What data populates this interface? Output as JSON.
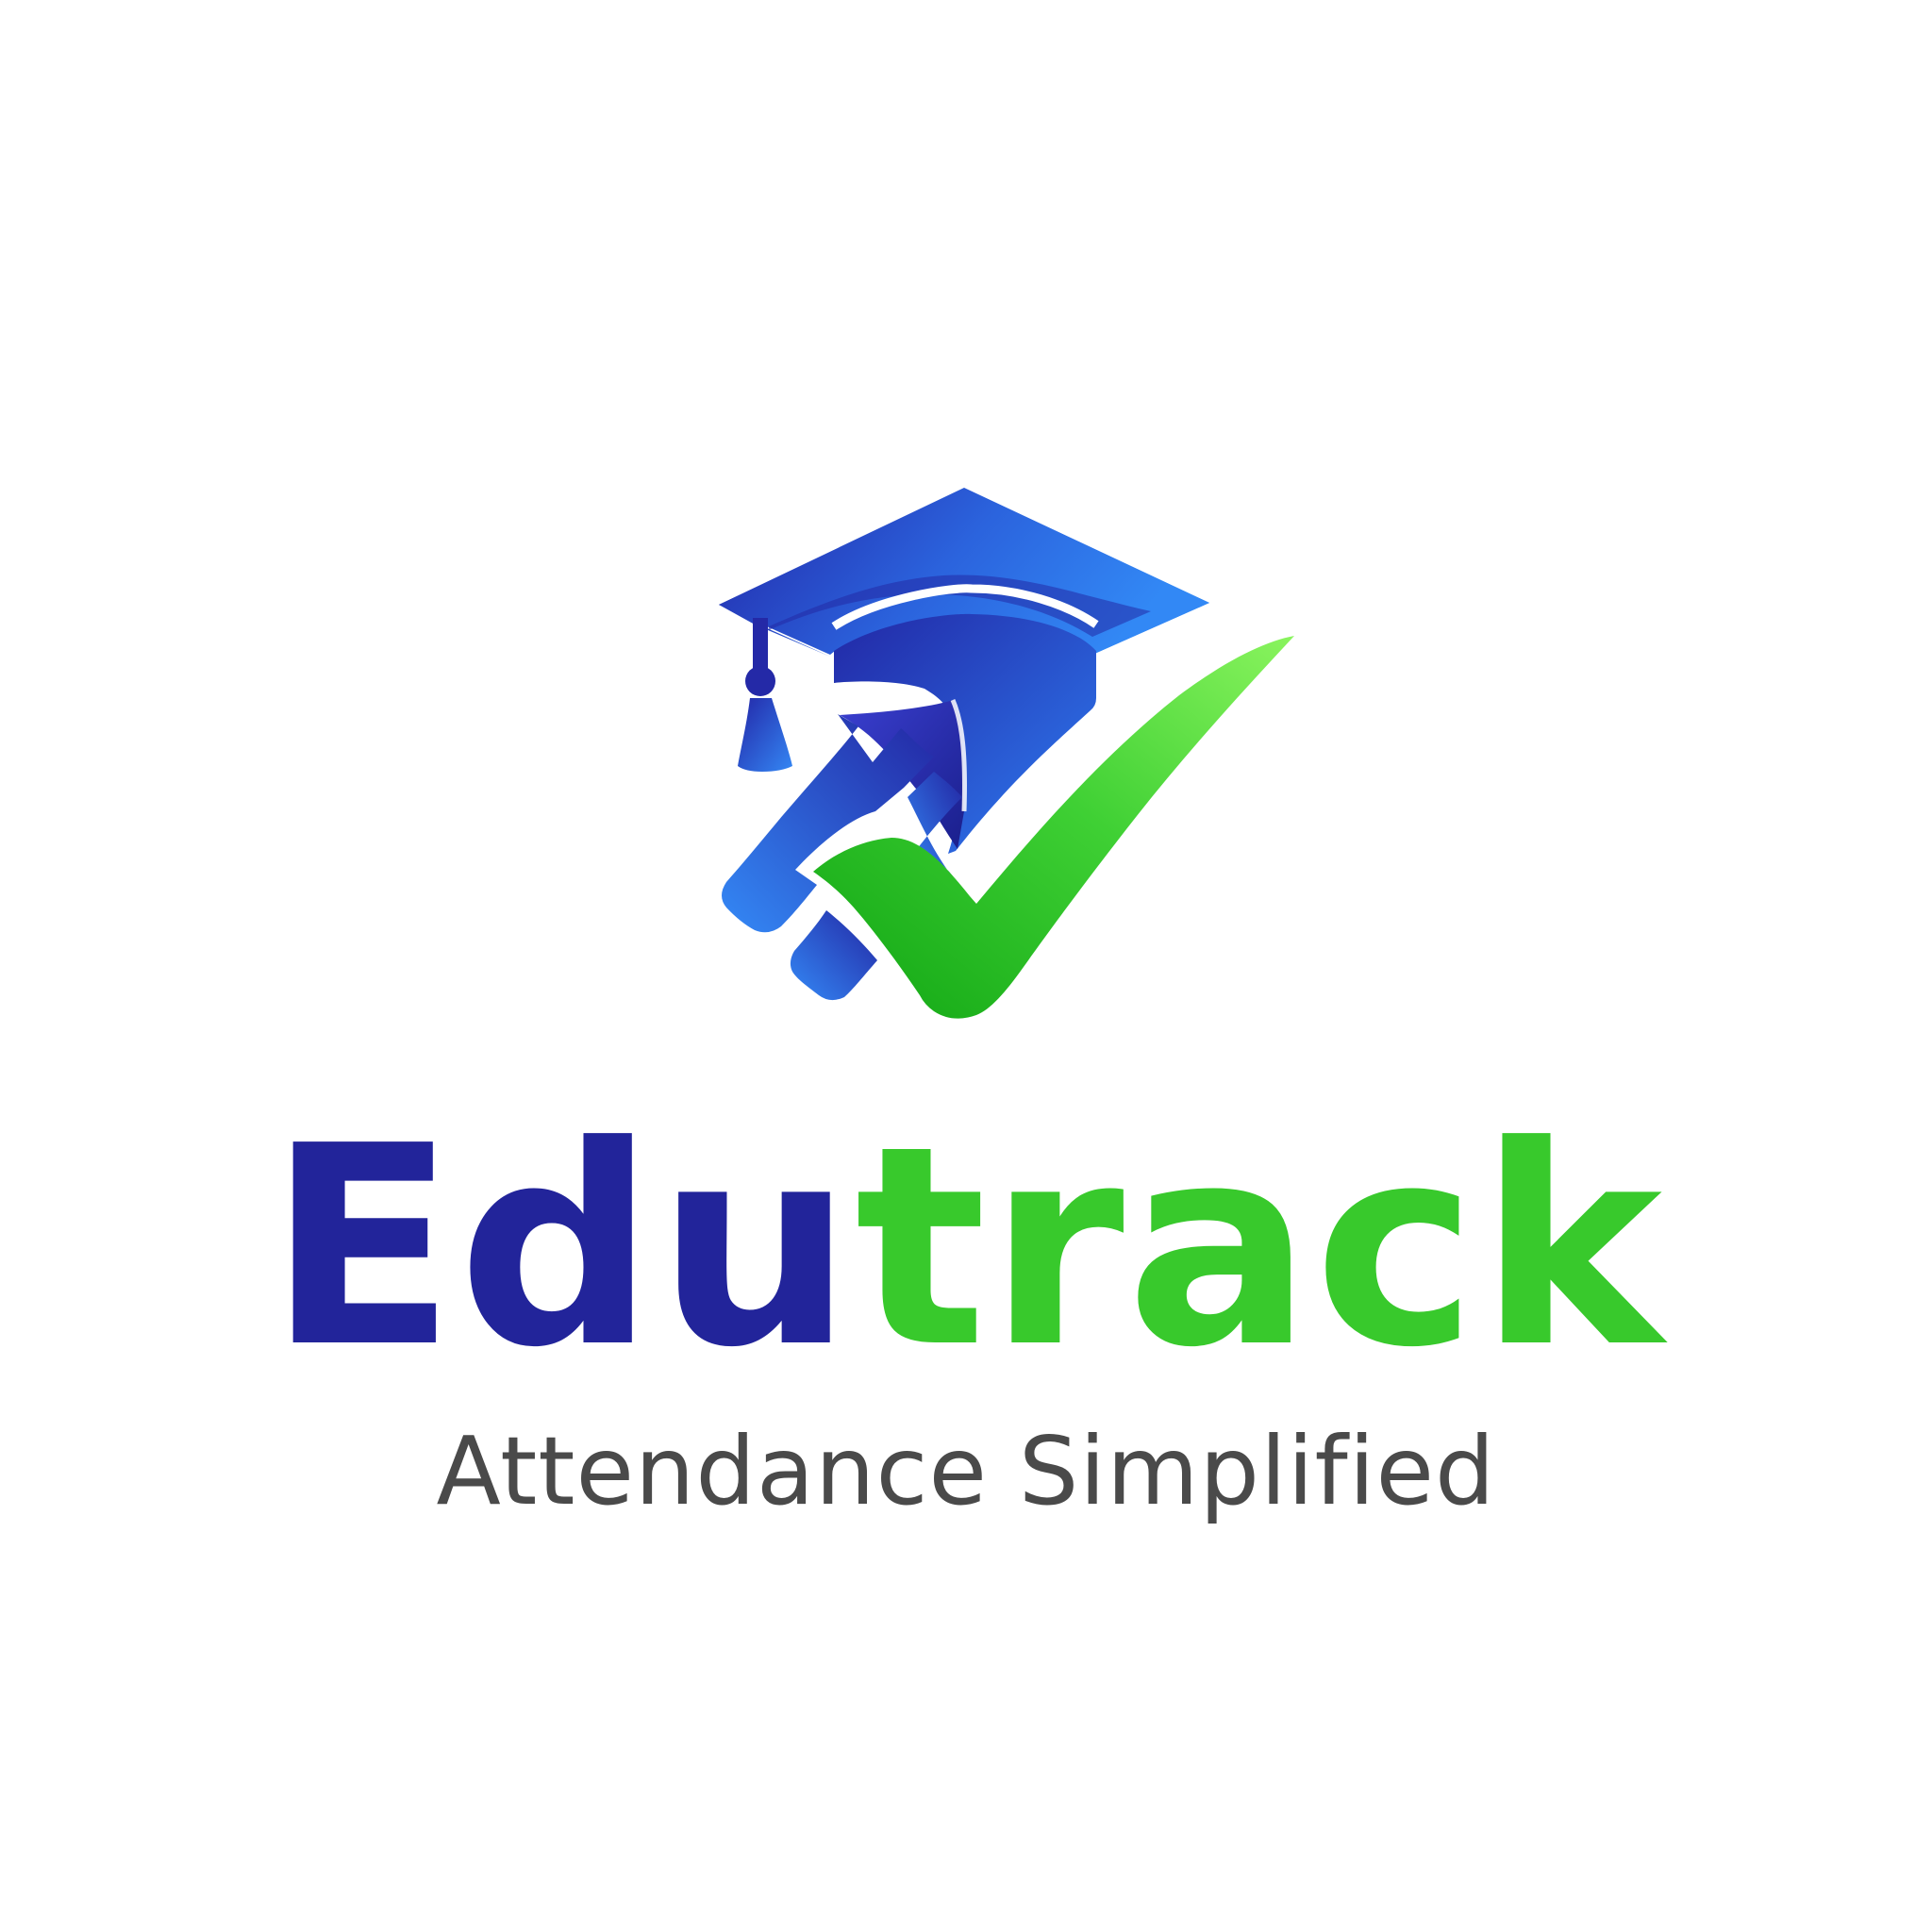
{
  "brand": {
    "name_part_1": "Edu",
    "name_part_2": "track",
    "tagline": "Attendance Simplified"
  },
  "colors": {
    "navy": "#22249a",
    "blue": "#2f80f0",
    "green": "#38c92c",
    "light_green": "#86f25a",
    "tagline_gray": "#4a4a4a",
    "background": "#ffffff"
  },
  "icons": {
    "cap": "graduation-cap-icon",
    "check": "checkmark-icon"
  }
}
